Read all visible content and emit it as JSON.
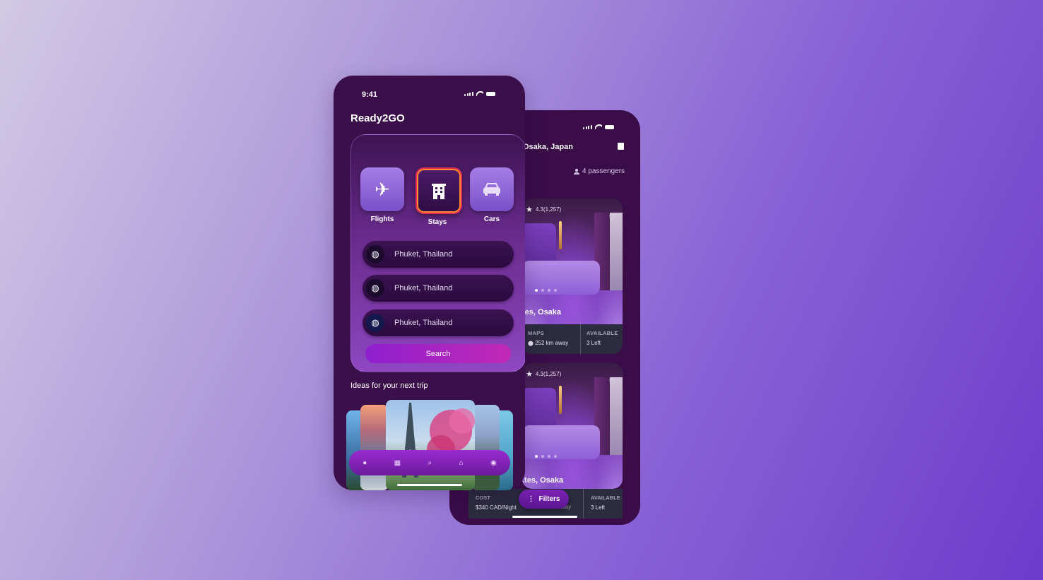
{
  "back_screen": {
    "location": "Osaka, Japan",
    "passengers": "4 passengers",
    "hotels": [
      {
        "rating": "4.3(1,257)",
        "name": "tes, Osaka",
        "maps_label": "MAPS",
        "distance": "252 km away",
        "available_label": "AVAILABLE",
        "available": "3 Left"
      },
      {
        "rating": "4.3(1,257)",
        "name": ".tes, Osaka",
        "cost_label": "COST",
        "cost": "$340 CAD/Night",
        "distance": "252 km away",
        "available_label": "AVAILABLE",
        "available": "3 Left"
      }
    ],
    "filters_label": "Filters"
  },
  "front_screen": {
    "time": "9:41",
    "app_title": "Ready2GO",
    "tabs": [
      {
        "label": "Flights",
        "icon": "airplane-icon"
      },
      {
        "label": "Stays",
        "icon": "building-icon"
      },
      {
        "label": "Cars",
        "icon": "car-icon"
      }
    ],
    "fields": [
      {
        "value": "Phuket, Thailand",
        "icon": "globe-icon"
      },
      {
        "value": "Phuket, Thailand",
        "icon": "globe-icon"
      },
      {
        "value": "Phuket, Thailand",
        "icon": "globe-icon"
      }
    ],
    "search_label": "Search",
    "ideas_title": "Ideas for your next trip",
    "nav_icons": [
      "pin-icon",
      "building-icon",
      "search-icon",
      "home-icon",
      "profile-icon"
    ]
  },
  "colors": {
    "phone_bg": "#3b0f49",
    "accent": "#b12ac0",
    "bg_start": "#d2c9e4",
    "bg_end": "#6e3bcb"
  }
}
